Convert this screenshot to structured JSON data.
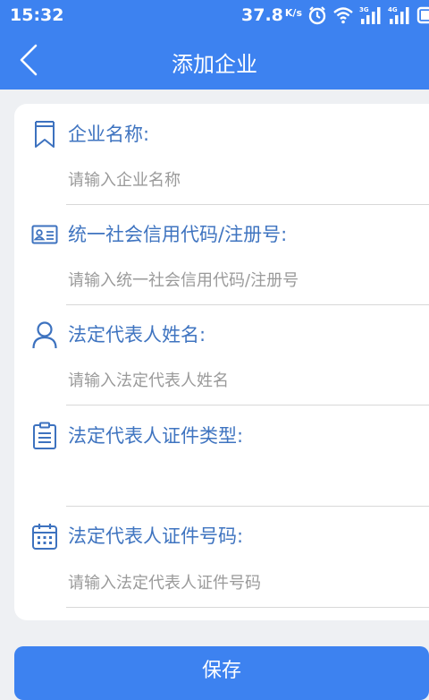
{
  "status_bar": {
    "time": "15:32",
    "speed": "37.8",
    "speed_unit": "K/s",
    "signal_1_label": "3G",
    "signal_2_label": "4G",
    "icons": [
      "alarm-icon",
      "wifi-icon",
      "signal-3g-icon",
      "signal-4g-icon",
      "battery-icon"
    ]
  },
  "header": {
    "back_icon": "chevron-left-icon",
    "title": "添加企业"
  },
  "form": {
    "fields": [
      {
        "icon": "bookmark-icon",
        "label": "企业名称:",
        "placeholder": "请输入企业名称",
        "value": ""
      },
      {
        "icon": "id-card-icon",
        "label": "统一社会信用代码/注册号:",
        "placeholder": "请输入统一社会信用代码/注册号",
        "value": ""
      },
      {
        "icon": "person-icon",
        "label": "法定代表人姓名:",
        "placeholder": "请输入法定代表人姓名",
        "value": ""
      },
      {
        "icon": "clipboard-icon",
        "label": "法定代表人证件类型:",
        "placeholder": "",
        "value": ""
      },
      {
        "icon": "calendar-icon",
        "label": "法定代表人证件号码:",
        "placeholder": "请输入法定代表人证件号码",
        "value": ""
      }
    ]
  },
  "submit": {
    "label": "保存"
  },
  "colors": {
    "primary": "#3d82f0",
    "label": "#3f74c0",
    "placeholder": "#9a9a9a",
    "background": "#eef0f3"
  }
}
